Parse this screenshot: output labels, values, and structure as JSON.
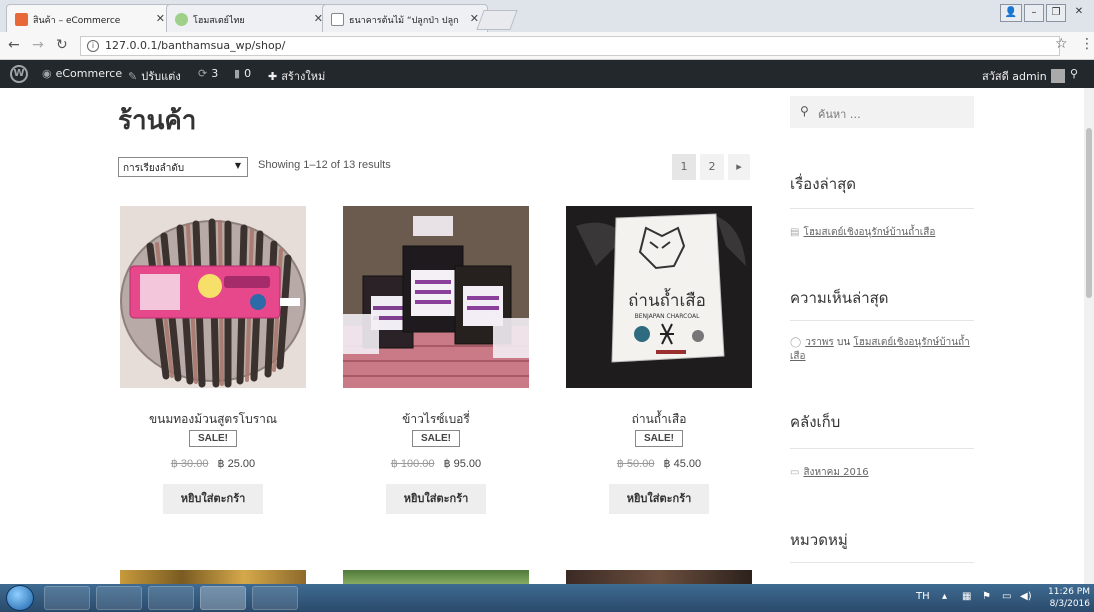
{
  "browser": {
    "tabs": [
      {
        "title": "สินค้า – eCommerce",
        "active": true
      },
      {
        "title": "โฮมสเตย์ไทย",
        "active": false
      },
      {
        "title": "ธนาคารต้นไม้ “ปลูกป่า ปลูก",
        "active": false
      }
    ],
    "url": "127.0.0.1/banthamsua_wp/shop/"
  },
  "adminbar": {
    "site_name": "eCommerce",
    "customize": "ปรับแต่ง",
    "updates": "3",
    "comments": "0",
    "new": "สร้างใหม่",
    "greeting": "สวัสดี admin"
  },
  "shop": {
    "title": "ร้านค้า",
    "sort_label": "การเรียงลำดับ",
    "result_count": "Showing 1–12 of 13 results",
    "pages": [
      "1",
      "2"
    ],
    "next": "▸",
    "products": [
      {
        "name": "ขนมทองม้วนสูตรโบราณ",
        "badge": "SALE!",
        "old_price": "฿ 30.00",
        "price": "฿ 25.00",
        "button": "หยิบใส่ตะกร้า"
      },
      {
        "name": "ข้าวไรซ์เบอรี่",
        "badge": "SALE!",
        "old_price": "฿ 100.00",
        "price": "฿ 95.00",
        "button": "หยิบใส่ตะกร้า"
      },
      {
        "name": "ถ่านถ้ำเสือ",
        "badge": "SALE!",
        "old_price": "฿ 50.00",
        "price": "฿ 45.00",
        "button": "หยิบใส่ตะกร้า"
      }
    ],
    "package_label": "ถ่านถ้ำเสือ",
    "package_sub": "BENJAPAN CHARCOAL"
  },
  "sidebar": {
    "search_placeholder": "ค้นหา …",
    "recent_posts_title": "เรื่องล่าสุด",
    "recent_post": "โฮมสเตย์เชิงอนุรักษ์บ้านถ้ำเสือ",
    "recent_comments_title": "ความเห็นล่าสุด",
    "comment_author": "วราพร",
    "comment_on": "บน",
    "comment_post": "โฮมสเตย์เชิงอนุรักษ์บ้านถ้ำเสือ",
    "archives_title": "คลังเก็บ",
    "archive_item": "สิงหาคม 2016",
    "categories_title": "หมวดหมู่"
  },
  "taskbar": {
    "lang": "TH",
    "time": "11:26 PM",
    "date": "8/3/2016"
  },
  "colors": {
    "adminbar_bg": "#23282d",
    "taskbar_bg": "#2a4a6b",
    "tab_bg": "#dfe3ea"
  }
}
